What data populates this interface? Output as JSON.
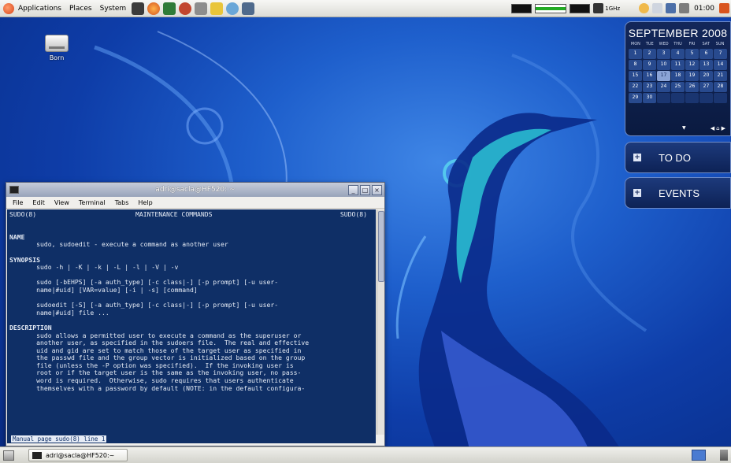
{
  "top_panel": {
    "menus": [
      "Applications",
      "Places",
      "System"
    ],
    "cpu_freq": "1GHz",
    "clock": "01:00",
    "launcher_icons": [
      "file-manager-icon",
      "firefox-icon",
      "messenger-icon",
      "chat-icon",
      "editor-icon",
      "package-icon",
      "weather-icon",
      "network-icon"
    ]
  },
  "desktop": {
    "icon_label": "Born"
  },
  "calendar": {
    "title": "SEPTEMBER 2008",
    "weekdays": [
      "MON",
      "TUE",
      "WED",
      "THU",
      "FRI",
      "SAT",
      "SUN"
    ],
    "days": [
      "1",
      "2",
      "3",
      "4",
      "5",
      "6",
      "7",
      "8",
      "9",
      "10",
      "11",
      "12",
      "13",
      "14",
      "15",
      "16",
      "17",
      "18",
      "19",
      "20",
      "21",
      "22",
      "23",
      "24",
      "25",
      "26",
      "27",
      "28",
      "29",
      "30"
    ],
    "today": "17"
  },
  "todo_widget": {
    "title": "TO DO"
  },
  "events_widget": {
    "title": "EVENTS"
  },
  "terminal": {
    "title": "adri@sacla@HF520: ~",
    "menu": [
      "File",
      "Edit",
      "View",
      "Terminal",
      "Tabs",
      "Help"
    ],
    "header_left": "SUDO(8)",
    "header_center": "MAINTENANCE COMMANDS",
    "header_right": "SUDO(8)",
    "name_heading": "NAME",
    "name_text": "sudo, sudoedit - execute a command as another user",
    "synopsis_heading": "SYNOPSIS",
    "synopsis_1": "sudo -h | -K | -k | -L | -l | -V | -v",
    "synopsis_2a": "sudo [-bEHPS] [-a auth_type] [-c class|-] [-p prompt] [-u user-",
    "synopsis_2b": "name|#uid] [VAR=value] [-i | -s] [command]",
    "synopsis_3a": "sudoedit [-S] [-a auth_type] [-c class|-] [-p prompt] [-u user-",
    "synopsis_3b": "name|#uid] file ...",
    "description_heading": "DESCRIPTION",
    "description_lines": [
      "sudo allows a permitted user to execute a command as the superuser or",
      "another user, as specified in the sudoers file.  The real and effective",
      "uid and gid are set to match those of the target user as specified in",
      "the passwd file and the group vector is initialized based on the group",
      "file (unless the -P option was specified).  If the invoking user is",
      "root or if the target user is the same as the invoking user, no pass-",
      "word is required.  Otherwise, sudo requires that users authenticate",
      "themselves with a password by default (NOTE: in the default configura-"
    ],
    "status": "Manual page sudo(8) line 1"
  },
  "bottom_panel": {
    "task_label": "adri@sacla@HF520:~"
  }
}
